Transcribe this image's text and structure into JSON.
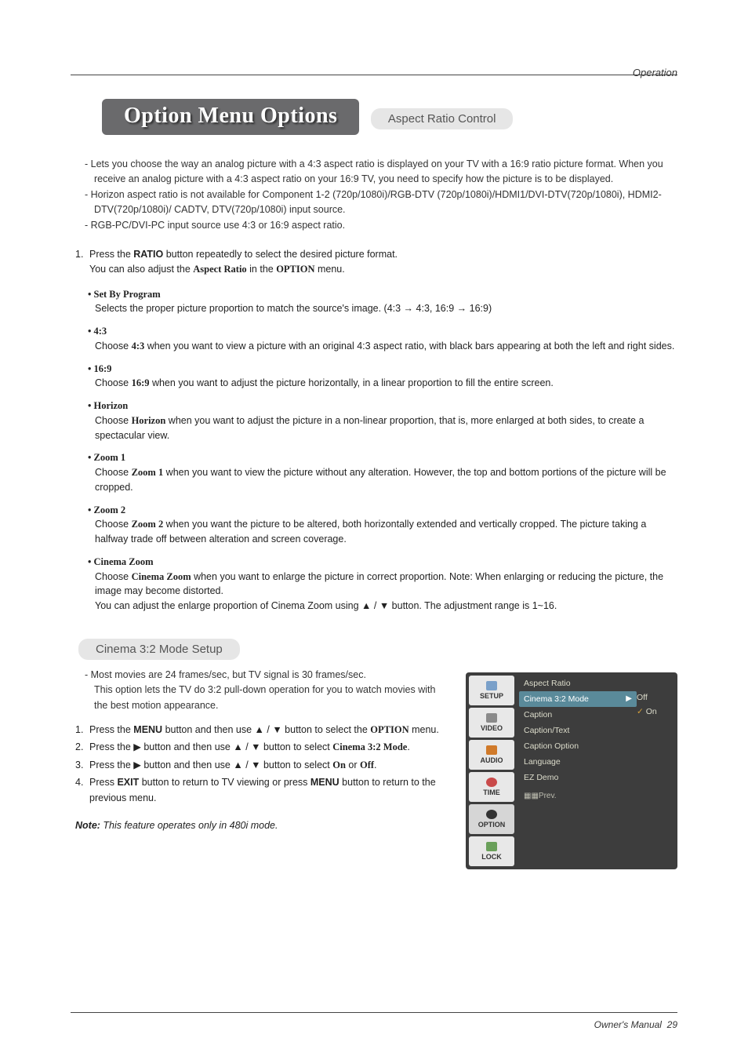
{
  "header": {
    "section": "Operation"
  },
  "title": "Option Menu Options",
  "aspect": {
    "heading": "Aspect Ratio Control",
    "bul1": "Lets you choose the way an analog picture with a 4:3 aspect ratio is displayed on your TV with a 16:9 ratio picture format. When you receive an analog picture with a 4:3 aspect ratio on your 16:9 TV, you need to specify how the picture is to be displayed.",
    "bul2": "Horizon aspect ratio is not available for Component 1-2 (720p/1080i)/RGB-DTV (720p/1080i)/HDMI1/DVI-DTV(720p/1080i), HDMI2-DTV(720p/1080i)/ CADTV, DTV(720p/1080i) input source.",
    "bul3": "RGB-PC/DVI-PC input source use 4:3 or 16:9 aspect ratio.",
    "step1_a": "Press the ",
    "step1_b": "RATIO",
    "step1_c": " button repeatedly to select the desired picture format.",
    "step1_sub_a": "You can also adjust the ",
    "step1_sub_b": "Aspect Ratio",
    "step1_sub_c": " in the ",
    "step1_sub_d": "OPTION",
    "step1_sub_e": " menu.",
    "items": {
      "setbyprogram": {
        "hd": "Set By Program",
        "body": "Selects the proper picture proportion to match the source's image.  (4:3 → 4:3, 16:9 → 16:9)"
      },
      "fourthree": {
        "hd": "4:3",
        "body_a": "Choose ",
        "body_b": "4:3",
        "body_c": " when you want to view a picture with an original 4:3 aspect ratio, with black bars appearing at both the left and right sides."
      },
      "sixteennine": {
        "hd": "16:9",
        "body_a": "Choose ",
        "body_b": "16:9",
        "body_c": " when you want to adjust the picture horizontally, in a linear proportion to fill the entire screen."
      },
      "horizon": {
        "hd": "Horizon",
        "body_a": "Choose ",
        "body_b": "Horizon",
        "body_c": " when you want to adjust the picture in a non-linear proportion, that is, more enlarged at both sides, to create a spectacular view."
      },
      "zoom1": {
        "hd": "Zoom 1",
        "body_a": "Choose ",
        "body_b": "Zoom 1",
        "body_c": " when you want to view the picture without any alteration. However, the top and bottom portions of the picture will be cropped."
      },
      "zoom2": {
        "hd": "Zoom 2",
        "body_a": "Choose ",
        "body_b": "Zoom 2",
        "body_c": " when you want the picture to be altered, both horizontally extended and vertically cropped. The picture taking a halfway trade off between alteration and screen coverage."
      },
      "cinema": {
        "hd": "Cinema Zoom",
        "body_a": "Choose ",
        "body_b": "Cinema Zoom",
        "body_c": " when you want to enlarge the picture in correct proportion. Note: When enlarging or reducing the picture, the image may become distorted.",
        "body2": "You can adjust the enlarge proportion of Cinema Zoom using ▲ / ▼ button. The adjustment range is 1~16."
      }
    }
  },
  "cinema32": {
    "heading": "Cinema 3:2 Mode Setup",
    "bul1": "Most movies are 24 frames/sec, but TV signal is 30 frames/sec.",
    "bul1b": "This option lets the TV do 3:2 pull-down operation for you to watch movies with the best motion appearance.",
    "steps": {
      "s1_a": "Press the  ",
      "s1_b": "MENU",
      "s1_c": " button and then use ▲ / ▼  button to select the ",
      "s1_d": "OPTION",
      "s1_e": " menu.",
      "s2_a": "Press the ▶ button and then use ▲ / ▼ button to select ",
      "s2_b": "Cinema 3:2 Mode",
      "s2_c": ".",
      "s3_a": "Press the ▶ button and then use ▲ / ▼ button to select ",
      "s3_b": "On",
      "s3_c": " or ",
      "s3_d": "Off",
      "s3_e": ".",
      "s4_a": "Press ",
      "s4_b": "EXIT",
      "s4_c": " button to return to TV viewing or press ",
      "s4_d": "MENU",
      "s4_e": " button to return to the previous menu."
    },
    "note_lbl": "Note:",
    "note_txt": " This feature operates only in 480i mode."
  },
  "menu": {
    "tabs": [
      "SETUP",
      "VIDEO",
      "AUDIO",
      "TIME",
      "OPTION",
      "LOCK"
    ],
    "rows": [
      "Aspect Ratio",
      "Cinema 3:2 Mode",
      "Caption",
      "Caption/Text",
      "Caption Option",
      "Language",
      "EZ Demo"
    ],
    "sel_arrow": "▶",
    "val_off": "Off",
    "val_on": "On",
    "check": "✓",
    "footer": "▦▦Prev."
  },
  "footer": {
    "label": "Owner's Manual",
    "page": "29"
  }
}
